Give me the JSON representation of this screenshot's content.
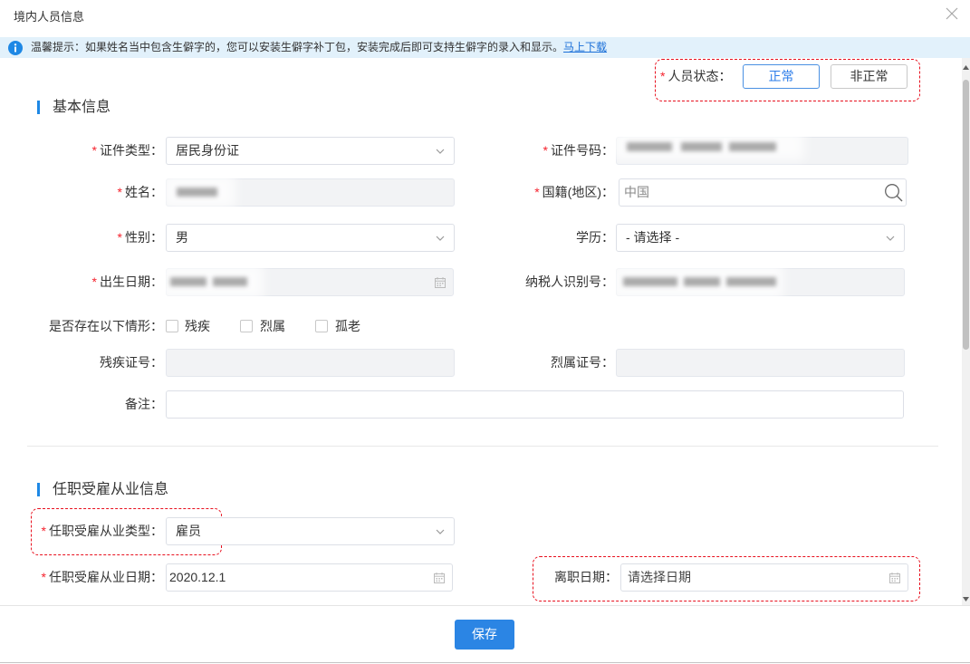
{
  "dialog": {
    "title": "境内人员信息"
  },
  "notice": {
    "text": "温馨提示：如果姓名当中包含生僻字的，您可以安装生僻字补丁包，安装完成后即可支持生僻字的录入和显示。",
    "link": "马上下载"
  },
  "required_mark": "*",
  "status": {
    "label": "人员状态：",
    "options": [
      {
        "label": "正常",
        "selected": true
      },
      {
        "label": "非正常",
        "selected": false
      }
    ]
  },
  "basic_info": {
    "title": "基本信息",
    "id_type": {
      "label": "证件类型：",
      "required": true,
      "value": "居民身份证"
    },
    "id_number": {
      "label": "证件号码：",
      "required": true
    },
    "name": {
      "label": "姓名：",
      "required": true
    },
    "nationality": {
      "label": "国籍(地区)：",
      "required": true,
      "value": "中国"
    },
    "gender": {
      "label": "性别：",
      "required": true,
      "value": "男"
    },
    "education": {
      "label": "学历：",
      "value": "- 请选择 -"
    },
    "birth_date": {
      "label": "出生日期：",
      "required": true
    },
    "taxpayer_id": {
      "label": "纳税人识别号："
    },
    "situations": {
      "label": "是否存在以下情形：",
      "options": [
        {
          "label": "残疾",
          "checked": false
        },
        {
          "label": "烈属",
          "checked": false
        },
        {
          "label": "孤老",
          "checked": false
        }
      ]
    },
    "disability_cert": {
      "label": "残疾证号："
    },
    "martyr_cert": {
      "label": "烈属证号："
    },
    "remarks": {
      "label": "备注："
    }
  },
  "employment_info": {
    "title": "任职受雇从业信息",
    "type": {
      "label": "任职受雇从业类型：",
      "required": true,
      "value": "雇员"
    },
    "start_date": {
      "label": "任职受雇从业日期：",
      "required": true,
      "value": "2020.12.1"
    },
    "leave_date": {
      "label": "离职日期：",
      "placeholder": "请选择日期"
    }
  },
  "footer": {
    "save_label": "保存"
  },
  "icons": {
    "close": "close-icon",
    "info": "info-icon",
    "dropdown": "chevron-down-icon",
    "date": "calendar-icon",
    "lookup": "search-icon"
  },
  "colors": {
    "primary": "#2b85e4",
    "required": "#f5222d",
    "highlight": "#e8101e",
    "notice_bg": "#e2f1fb"
  }
}
